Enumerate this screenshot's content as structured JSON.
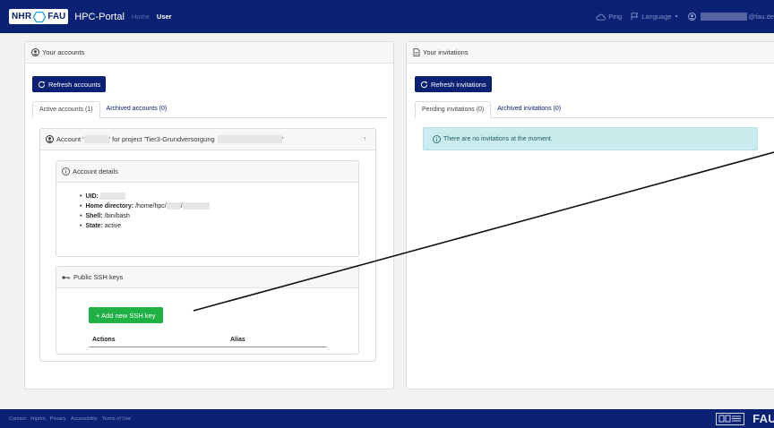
{
  "brand": {
    "logo_left": "NHR",
    "logo_right": "FAU",
    "title": "HPC-Portal"
  },
  "nav": {
    "home": "Home",
    "user": "User",
    "ping": "Ping",
    "language": "Language",
    "user_email_suffix": "@fau.de",
    "color_primary": "#0a2174"
  },
  "accounts": {
    "header": "Your accounts",
    "refresh_label": "Refresh accounts",
    "tabs": [
      {
        "label": "Active accounts (1)",
        "active": true
      },
      {
        "label": "Archived accounts (0)",
        "active": false
      }
    ],
    "account_card": {
      "title_prefix": "Account '",
      "title_middle": "' for project 'Tier3-Grundversorgung",
      "title_suffix": "'",
      "toggle_icon": "↑",
      "details": {
        "header": "Account details",
        "uid_label": "UID:",
        "home_label": "Home directory:",
        "home_value": "/home/hpc/",
        "home_sep": "/",
        "shell_label": "Shell:",
        "shell_value": "/bin/bash",
        "state_label": "State:",
        "state_value": "active"
      },
      "ssh": {
        "header": "Public SSH keys",
        "add_button": "+ Add new SSH key",
        "columns": [
          "Actions",
          "Alias"
        ]
      }
    }
  },
  "invitations": {
    "header": "Your invitations",
    "refresh_label": "Refresh invitations",
    "tabs": [
      {
        "label": "Pending invitations (0)",
        "active": true
      },
      {
        "label": "Archived invitations (0)",
        "active": false
      }
    ],
    "empty_message": "There are no invitations at the moment."
  },
  "footer": {
    "links": [
      "Contact",
      "Imprint",
      "Privacy",
      "Accessibility",
      "Terms of Use"
    ],
    "logo_text": "FAU"
  }
}
